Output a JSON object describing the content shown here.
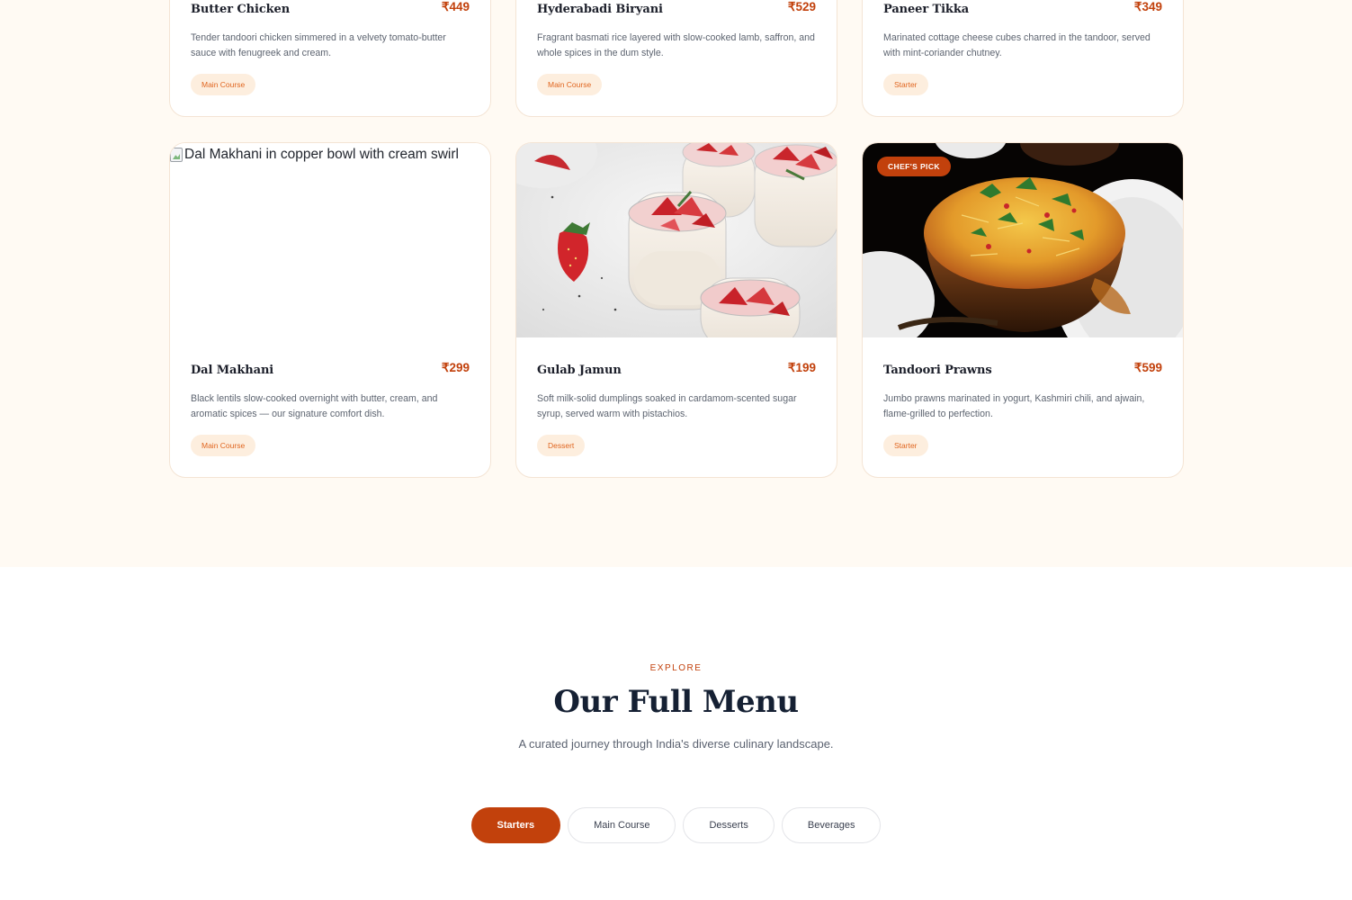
{
  "dishes_section": {
    "cards": [
      {
        "name": "Butter Chicken",
        "price": "₹449",
        "description": "Tender tandoori chicken simmered in a velvety tomato-butter sauce with fenugreek and cream.",
        "tag": "Main Course"
      },
      {
        "name": "Hyderabadi Biryani",
        "price": "₹529",
        "description": "Fragrant basmati rice layered with slow-cooked lamb, saffron, and whole spices in the dum style.",
        "tag": "Main Course"
      },
      {
        "name": "Paneer Tikka",
        "price": "₹349",
        "description": "Marinated cottage cheese cubes charred in the tandoor, served with mint-coriander chutney.",
        "tag": "Starter"
      },
      {
        "name": "Dal Makhani",
        "price": "₹299",
        "description": "Black lentils slow-cooked overnight with butter, cream, and aromatic spices — our signature comfort dish.",
        "tag": "Main Course",
        "image_alt": "Dal Makhani in copper bowl with cream swirl"
      },
      {
        "name": "Gulab Jamun",
        "price": "₹199",
        "description": "Soft milk-solid dumplings soaked in cardamom-scented sugar syrup, served warm with pistachios.",
        "tag": "Dessert",
        "image": "strawberry panna cotta jars"
      },
      {
        "name": "Tandoori Prawns",
        "price": "₹599",
        "description": "Jumbo prawns marinated in yogurt, Kashmiri chili, and ajwain, flame-grilled to perfection.",
        "tag": "Starter",
        "badge": "CHEF'S PICK",
        "image": "biryani in copper bowl"
      }
    ]
  },
  "menu_section": {
    "eyebrow": "EXPLORE",
    "title": "Our Full Menu",
    "subtitle": "A curated journey through India's diverse culinary landscape.",
    "tabs": [
      {
        "label": "Starters",
        "active": true
      },
      {
        "label": "Main Course",
        "active": false
      },
      {
        "label": "Desserts",
        "active": false
      },
      {
        "label": "Beverages",
        "active": false
      }
    ]
  },
  "colors": {
    "accent": "#c2410c",
    "tag_bg": "#fdeede",
    "section_bg": "#fffaf3"
  }
}
